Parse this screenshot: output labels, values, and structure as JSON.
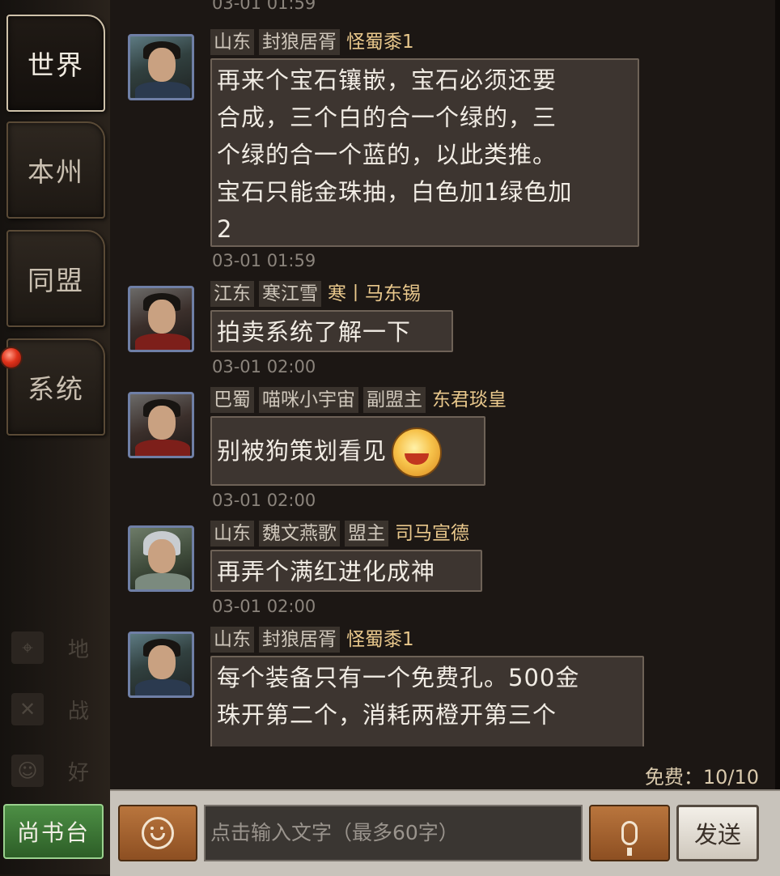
{
  "tabs": [
    {
      "label": "世界",
      "active": true
    },
    {
      "label": "本州",
      "active": false
    },
    {
      "label": "同盟",
      "active": false
    },
    {
      "label": "系统",
      "active": false,
      "notification": true
    }
  ],
  "side_menu": [
    {
      "label": "地",
      "icon": "map-pin-icon"
    },
    {
      "label": "战",
      "icon": "crossed-swords-icon"
    },
    {
      "label": "好",
      "icon": "friends-icon"
    }
  ],
  "top_cut_timestamp": "03-01 01:59",
  "messages": [
    {
      "tags": [
        "山东",
        "封狼居胥"
      ],
      "name": "怪蜀黍1",
      "avatar": "young-general-avatar",
      "lines": [
        "再来个宝石镶嵌，宝石必须还要",
        "合成，三个白的合一个绿的，三",
        "个绿的合一个蓝的，以此类推。",
        "宝石只能金珠抽，白色加1绿色加",
        "2"
      ],
      "time": "03-01 01:59"
    },
    {
      "tags": [
        "江东",
        "寒江雪"
      ],
      "name": "寒丨马东锡",
      "avatar": "bearded-general-avatar",
      "lines": [
        "拍卖系统了解一下"
      ],
      "time": "03-01 02:00"
    },
    {
      "tags": [
        "巴蜀",
        "喵咪小宇宙",
        "副盟主"
      ],
      "name": "东君琰皇",
      "avatar": "bearded-general-avatar",
      "lines": [
        "别被狗策划看见"
      ],
      "emoji": "laughing-emoji",
      "time": "03-01 02:00"
    },
    {
      "tags": [
        "山东",
        "魏文燕歌",
        "盟主"
      ],
      "name": "司马宣德",
      "avatar": "helmet-general-avatar",
      "lines": [
        "再弄个满红进化成神"
      ],
      "time": "03-01 02:00"
    },
    {
      "tags": [
        "山东",
        "封狼居胥"
      ],
      "name": "怪蜀黍1",
      "avatar": "young-general-avatar",
      "lines": [
        "每个装备只有一个免费孔。500金",
        "珠开第二个，消耗两橙开第三个"
      ],
      "time": ""
    }
  ],
  "free_label": "免费：10/10",
  "input": {
    "placeholder": "点击输入文字（最多60字）"
  },
  "buttons": {
    "send": "发送",
    "shangshutai": "尚书台"
  },
  "colors": {
    "name": "#e9c88c",
    "accent_button": "#8d4f22",
    "green_button": "#2d5e27"
  }
}
